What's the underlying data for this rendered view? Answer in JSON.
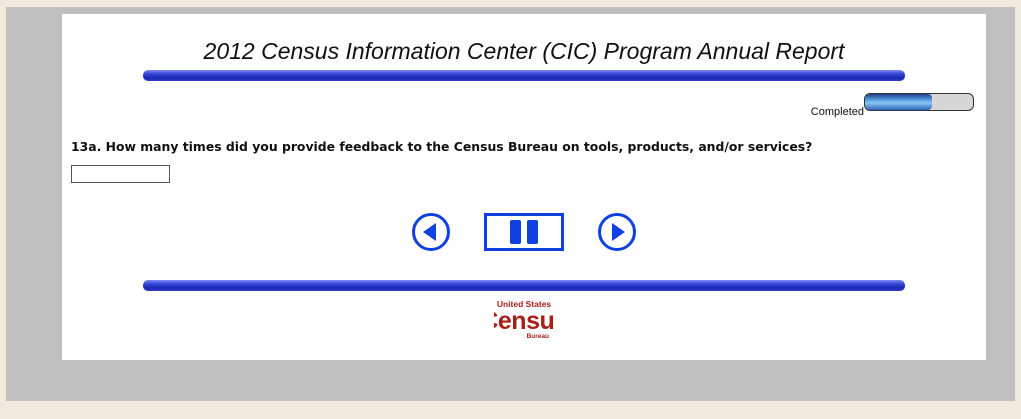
{
  "survey": {
    "title": "2012 Census Information Center (CIC) Program Annual Report",
    "progress": {
      "label": "Completed",
      "fraction": 0.62
    },
    "question": {
      "text": "13a. How many times did you provide feedback to the Census Bureau on tools, products, and/or services?",
      "answer_value": ""
    },
    "nav": {
      "previous_icon": "left-arrow-circle-icon",
      "pause_icon": "pause-icon",
      "next_icon": "right-arrow-circle-icon"
    },
    "footer_logo": {
      "line1": "United States",
      "line2": "Census",
      "line3": "Bureau"
    }
  },
  "colors": {
    "page_background": "#efebdc",
    "frame": "#c0c0c0",
    "accent_blue": "#1a28b5",
    "nav_icon_blue": "#1040e0",
    "census_red": "#a8201a"
  }
}
